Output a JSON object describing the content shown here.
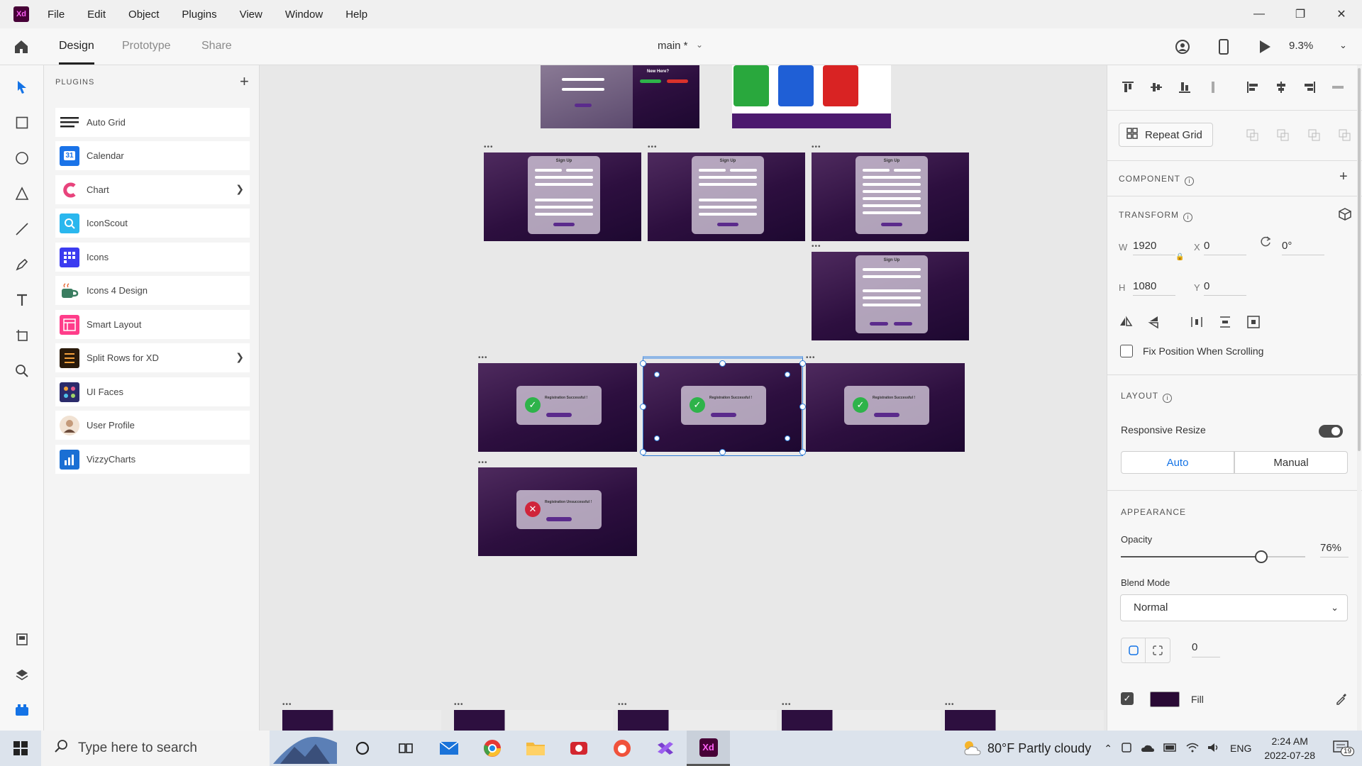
{
  "app": {
    "logo_text": "Xd",
    "menu": [
      "File",
      "Edit",
      "Object",
      "Plugins",
      "View",
      "Window",
      "Help"
    ],
    "window_controls": [
      "minimize",
      "restore",
      "close"
    ]
  },
  "toolbar": {
    "tabs": [
      "Design",
      "Prototype",
      "Share"
    ],
    "active_tab": "Design",
    "document_title": "main *",
    "zoom": "9.3%"
  },
  "plugins": {
    "title": "PLUGINS",
    "items": [
      {
        "name": "Auto Grid",
        "icon": "auto-grid-icon",
        "color": "#ffffff",
        "chevron": false
      },
      {
        "name": "Calendar",
        "icon": "calendar-icon",
        "color": "#1a73e8",
        "chevron": false
      },
      {
        "name": "Chart",
        "icon": "chart-icon",
        "color": "#ffffff",
        "chevron": true
      },
      {
        "name": "IconScout",
        "icon": "iconscout-icon",
        "color": "#2ab7ee",
        "chevron": false
      },
      {
        "name": "Icons",
        "icon": "icons-icon",
        "color": "#3b3bf0",
        "chevron": false
      },
      {
        "name": "Icons 4 Design",
        "icon": "icons4design-icon",
        "color": "#3a7d60",
        "chevron": false
      },
      {
        "name": "Smart Layout",
        "icon": "smart-layout-icon",
        "color": "#ff3d8a",
        "chevron": false
      },
      {
        "name": "Split Rows for XD",
        "icon": "split-rows-icon",
        "color": "#2a1a0a",
        "chevron": true
      },
      {
        "name": "UI Faces",
        "icon": "ui-faces-icon",
        "color": "#2b2b6b",
        "chevron": false
      },
      {
        "name": "User Profile",
        "icon": "user-profile-icon",
        "color": "#e9d2b8",
        "chevron": false
      },
      {
        "name": "VizzyCharts",
        "icon": "vizzycharts-icon",
        "color": "#1a6fd4",
        "chevron": false
      }
    ]
  },
  "canvas": {
    "signup_title": "Sign Up",
    "new_here": "New Here?",
    "reg_success": "Registration Successful !",
    "reg_fail": "Registration Unsuccessful !"
  },
  "properties": {
    "repeat_grid": "Repeat Grid",
    "component_label": "COMPONENT",
    "transform_label": "TRANSFORM",
    "w_label": "W",
    "w": "1920",
    "h_label": "H",
    "h": "1080",
    "x_label": "X",
    "x": "0",
    "y_label": "Y",
    "y": "0",
    "rotation": "0°",
    "fix_position": "Fix Position When Scrolling",
    "layout_label": "LAYOUT",
    "responsive_resize": "Responsive Resize",
    "responsive_on": true,
    "auto": "Auto",
    "manual": "Manual",
    "appearance_label": "APPEARANCE",
    "opacity_label": "Opacity",
    "opacity": "76%",
    "opacity_value": 0.76,
    "blend_label": "Blend Mode",
    "blend_mode": "Normal",
    "corner_radius": "0",
    "fill_label": "Fill",
    "fill_color": "#2a0a35",
    "accent": "#2e7bd6"
  },
  "taskbar": {
    "search_placeholder": "Type here to search",
    "weather": "80°F  Partly cloudy",
    "language": "ENG",
    "time": "2:24 AM",
    "date": "2022-07-28",
    "notifications": "19"
  }
}
